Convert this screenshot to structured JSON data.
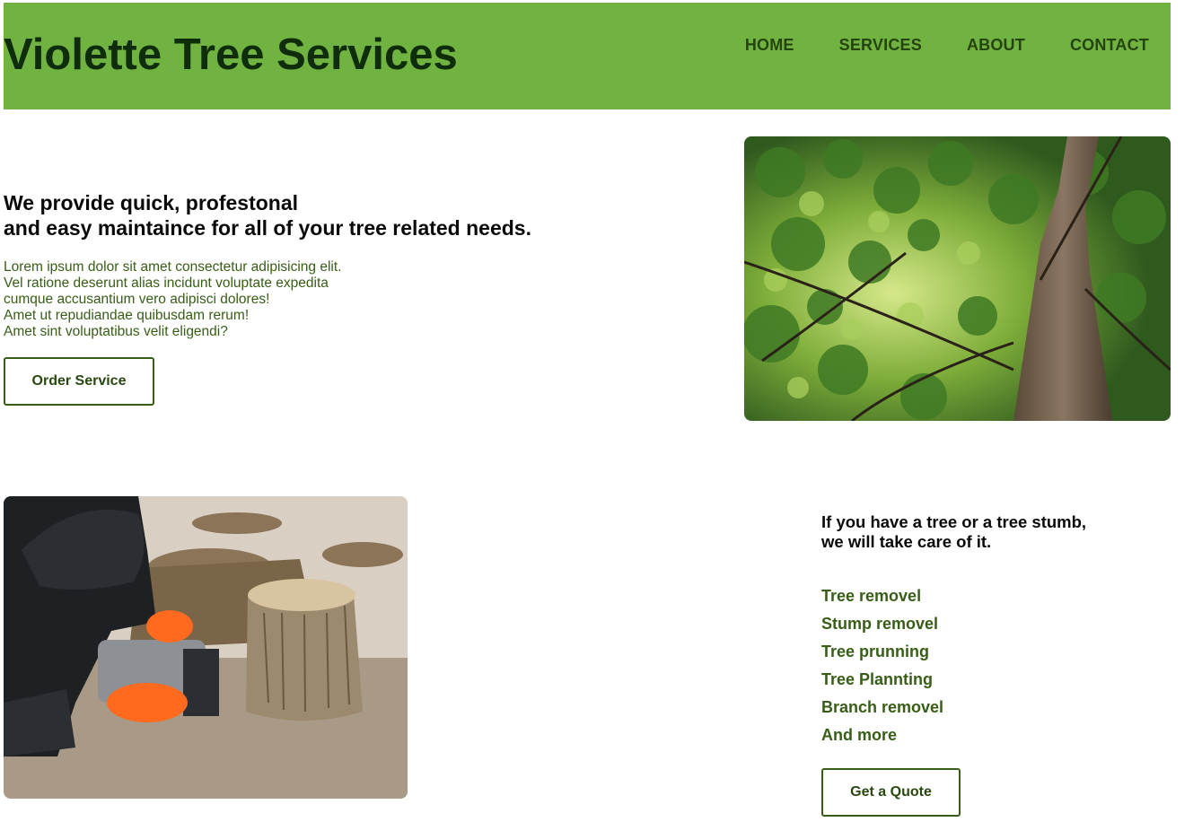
{
  "header": {
    "title": "Violette Tree Services",
    "nav": [
      "HOME",
      "SERVICES",
      "ABOUT",
      "CONTACT"
    ],
    "background_color": "#70b340"
  },
  "hero": {
    "heading_line1": "We provide quick, profestonal",
    "heading_line2": "and easy maintaince for all of your tree related needs.",
    "paragraph_lines": [
      "Lorem ipsum dolor sit amet consectetur adipisicing elit.",
      "Vel ratione deserunt alias incidunt voluptate expedita",
      "cumque accusantium vero adipisci dolores!",
      "Amet ut repudiandae quibusdam rerum!",
      "Amet sint voluptatibus velit eligendi?"
    ],
    "button_label": "Order Service"
  },
  "services": {
    "heading_line1": "If you have a tree or a tree stumb,",
    "heading_line2": "we will take care of it.",
    "items": [
      "Tree removel",
      "Stump removel",
      "Tree prunning",
      "Tree Plannting",
      "Branch removel",
      "And more"
    ],
    "button_label": "Get a Quote"
  },
  "colors": {
    "accent_green": "#70b340",
    "dark_green_text": "#375d16",
    "title_dark": "#102d0b"
  }
}
